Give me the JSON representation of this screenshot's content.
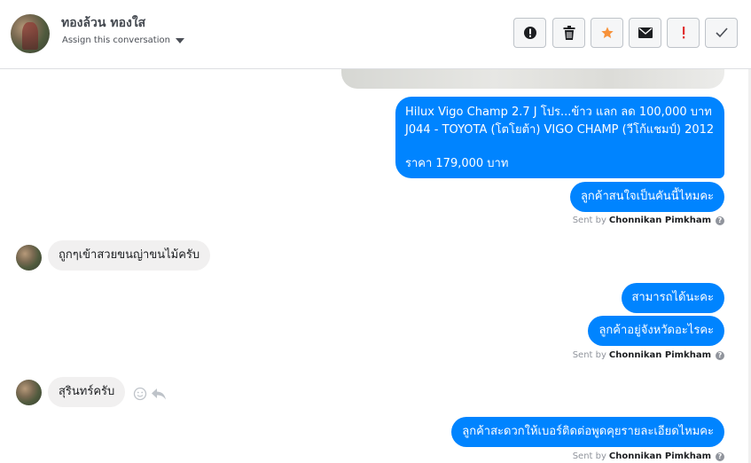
{
  "header": {
    "contact_name": "ทองล้วน ทองใส",
    "assign_label": "Assign this conversation"
  },
  "toolbar": {
    "buttons": [
      {
        "name": "mark-spam-button",
        "icon": "alert-circle-icon"
      },
      {
        "name": "delete-button",
        "icon": "trash-icon"
      },
      {
        "name": "star-button",
        "icon": "star-icon",
        "color": "#f7923a"
      },
      {
        "name": "mark-unread-button",
        "icon": "envelope-icon"
      },
      {
        "name": "follow-up-button",
        "icon": "exclamation-icon",
        "color": "#e02f2f"
      },
      {
        "name": "mark-done-button",
        "icon": "check-icon"
      }
    ]
  },
  "colors": {
    "outgoing_bubble": "#0084ff",
    "incoming_bubble": "#f1f0f0"
  },
  "messages": {
    "ad_line1": "Hilux Vigo Champ 2.7 J โปร...ข้าว แลก ลด 100,000 บาท",
    "ad_line2": "J044 - TOYOTA (โตโยต้า) VIGO CHAMP (วีโก้แชมป์) 2012",
    "ad_line3": "ราคา 179,000 บาท",
    "out1": "ลูกค้าสนใจเป็นคันนี้ไหมคะ",
    "in1": "ถูกๆเข้าสวยขนญ่าขนไม้ครับ",
    "out2": "สามารถได้นะคะ",
    "out3": "ลูกค้าอยู่จังหวัดอะไรคะ",
    "in2": "สุรินทร์ครับ",
    "out4": "ลูกค้าสะดวกให้เบอร์ติดต่อพูดคุยรายละเอียดไหมคะ"
  },
  "sent_by": {
    "prefix": "Sent by",
    "agent": "Chonnikan Pimkham"
  }
}
